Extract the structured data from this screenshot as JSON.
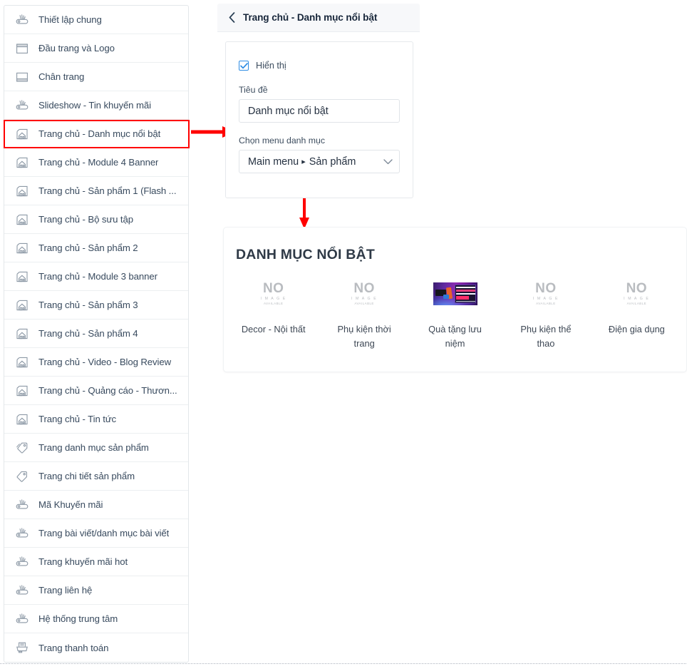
{
  "sidebar": {
    "items": [
      {
        "label": "Thiết lập chung",
        "icon": "settings-knife-icon",
        "selected": false
      },
      {
        "label": "Đầu trang và Logo",
        "icon": "header-logo-icon",
        "selected": false
      },
      {
        "label": "Chân trang",
        "icon": "footer-icon",
        "selected": false
      },
      {
        "label": "Slideshow - Tin khuyến mãi",
        "icon": "settings-knife-icon",
        "selected": false
      },
      {
        "label": "Trang chủ - Danh mục nổi bật",
        "icon": "home-module-icon",
        "selected": true
      },
      {
        "label": "Trang chủ - Module 4 Banner",
        "icon": "home-module-icon",
        "selected": false
      },
      {
        "label": "Trang chủ - Sản phẩm 1 (Flash ...",
        "icon": "home-module-icon",
        "selected": false
      },
      {
        "label": "Trang chủ - Bộ sưu tập",
        "icon": "home-module-icon",
        "selected": false
      },
      {
        "label": "Trang chủ - Sản phẩm 2",
        "icon": "home-module-icon",
        "selected": false
      },
      {
        "label": "Trang chủ - Module 3 banner",
        "icon": "home-module-icon",
        "selected": false
      },
      {
        "label": "Trang chủ - Sản phẩm 3",
        "icon": "home-module-icon",
        "selected": false
      },
      {
        "label": "Trang chủ - Sản phẩm 4",
        "icon": "home-module-icon",
        "selected": false
      },
      {
        "label": "Trang chủ - Video - Blog Review",
        "icon": "home-module-icon",
        "selected": false
      },
      {
        "label": "Trang chủ - Quảng cáo - Thươn...",
        "icon": "home-module-icon",
        "selected": false
      },
      {
        "label": "Trang chủ - Tin tức",
        "icon": "home-module-icon",
        "selected": false
      },
      {
        "label": "Trang danh mục sản phẩm",
        "icon": "tags-icon",
        "selected": false
      },
      {
        "label": "Trang chi tiết sản phẩm",
        "icon": "tag-icon",
        "selected": false
      },
      {
        "label": "Mã Khuyến mãi",
        "icon": "settings-knife-icon",
        "selected": false
      },
      {
        "label": "Trang bài viết/danh mục bài viết",
        "icon": "settings-knife-icon",
        "selected": false
      },
      {
        "label": "Trang khuyến mãi hot",
        "icon": "settings-knife-icon",
        "selected": false
      },
      {
        "label": "Trang liên hệ",
        "icon": "settings-knife-icon",
        "selected": false
      },
      {
        "label": "Hệ thống trung tâm",
        "icon": "settings-knife-icon",
        "selected": false
      },
      {
        "label": "Trang thanh toán",
        "icon": "printer-icon",
        "selected": false
      }
    ]
  },
  "panel": {
    "back_icon": "chevron-left-icon",
    "title": "Trang chủ - Danh mục nổi bật",
    "visibility": {
      "label": "Hiển thị",
      "checked": true
    },
    "title_field": {
      "label": "Tiêu đề",
      "value": "Danh mục nổi bật",
      "placeholder": "Tiêu đề"
    },
    "menu_field": {
      "label": "Chọn menu danh mục",
      "value_prefix": "Main menu",
      "value_separator": "▸",
      "value_suffix": "Sản phẩm",
      "caret_icon": "chevron-down-icon"
    }
  },
  "preview": {
    "heading": "DANH MỤC NỔI BẬT",
    "placeholder_image": {
      "line1": "NO",
      "line2": "I M A G E",
      "line3": "AVAILABLE"
    },
    "categories": [
      {
        "name": "Decor - Nội thất",
        "thumb": "no-image"
      },
      {
        "name": "Phụ kiện thời trang",
        "thumb": "no-image"
      },
      {
        "name": "Quà tặng lưu niệm",
        "thumb": "banner-image"
      },
      {
        "name": "Phụ kiện thể thao",
        "thumb": "no-image"
      },
      {
        "name": "Điện gia dụng",
        "thumb": "no-image"
      }
    ]
  },
  "annotations": {
    "arrow_right": "red-arrow-right",
    "arrow_down": "red-arrow-down",
    "highlight": "red-highlight-box",
    "color": "#ff0000"
  }
}
